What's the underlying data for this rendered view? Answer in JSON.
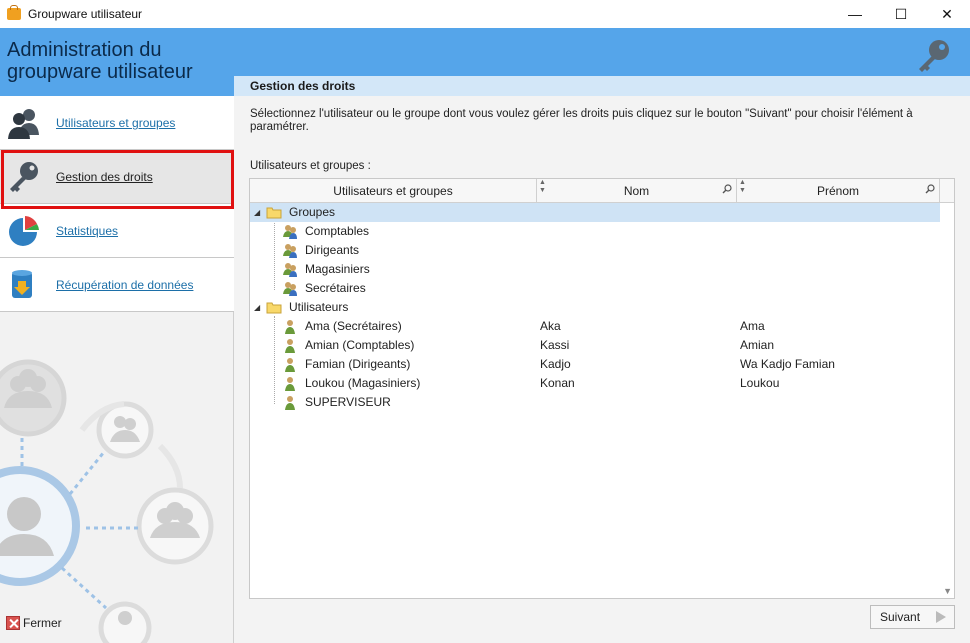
{
  "window": {
    "title": "Groupware utilisateur",
    "minimize_glyph": "—",
    "maximize_glyph": "☐",
    "close_glyph": "✕"
  },
  "header": {
    "app_title": "Administration du groupware utilisateur",
    "accent_color": "#55a5ea"
  },
  "sidebar": {
    "items": [
      {
        "label": "Utilisateurs et groupes",
        "icon": "users-icon"
      },
      {
        "label": "Gestion des droits",
        "icon": "key-icon",
        "selected": true
      },
      {
        "label": "Statistiques",
        "icon": "pie-chart-icon"
      },
      {
        "label": "Récupération de données",
        "icon": "database-download-icon"
      }
    ],
    "close_label": "Fermer"
  },
  "main": {
    "section_title": "Gestion des droits",
    "instructions": "Sélectionnez l'utilisateur ou le groupe dont vous voulez gérer les droits puis cliquez sur le bouton \"Suivant\" pour choisir l'élément à paramétrer.",
    "grid_label": "Utilisateurs et groupes :",
    "columns": [
      "Utilisateurs et groupes",
      "Nom",
      "Prénom"
    ],
    "groups_label": "Groupes",
    "groups": [
      "Comptables",
      "Dirigeants",
      "Magasiniers",
      "Secrétaires"
    ],
    "users_label": "Utilisateurs",
    "users": [
      {
        "name": "Ama (Secrétaires)",
        "nom": "Aka",
        "prenom": "Ama"
      },
      {
        "name": "Amian (Comptables)",
        "nom": "Kassi",
        "prenom": "Amian"
      },
      {
        "name": "Famian (Dirigeants)",
        "nom": "Kadjo",
        "prenom": "Wa Kadjo Famian"
      },
      {
        "name": "Loukou (Magasiniers)",
        "nom": "Konan",
        "prenom": "Loukou"
      },
      {
        "name": "SUPERVISEUR",
        "nom": "",
        "prenom": ""
      }
    ],
    "next_label": "Suivant"
  }
}
